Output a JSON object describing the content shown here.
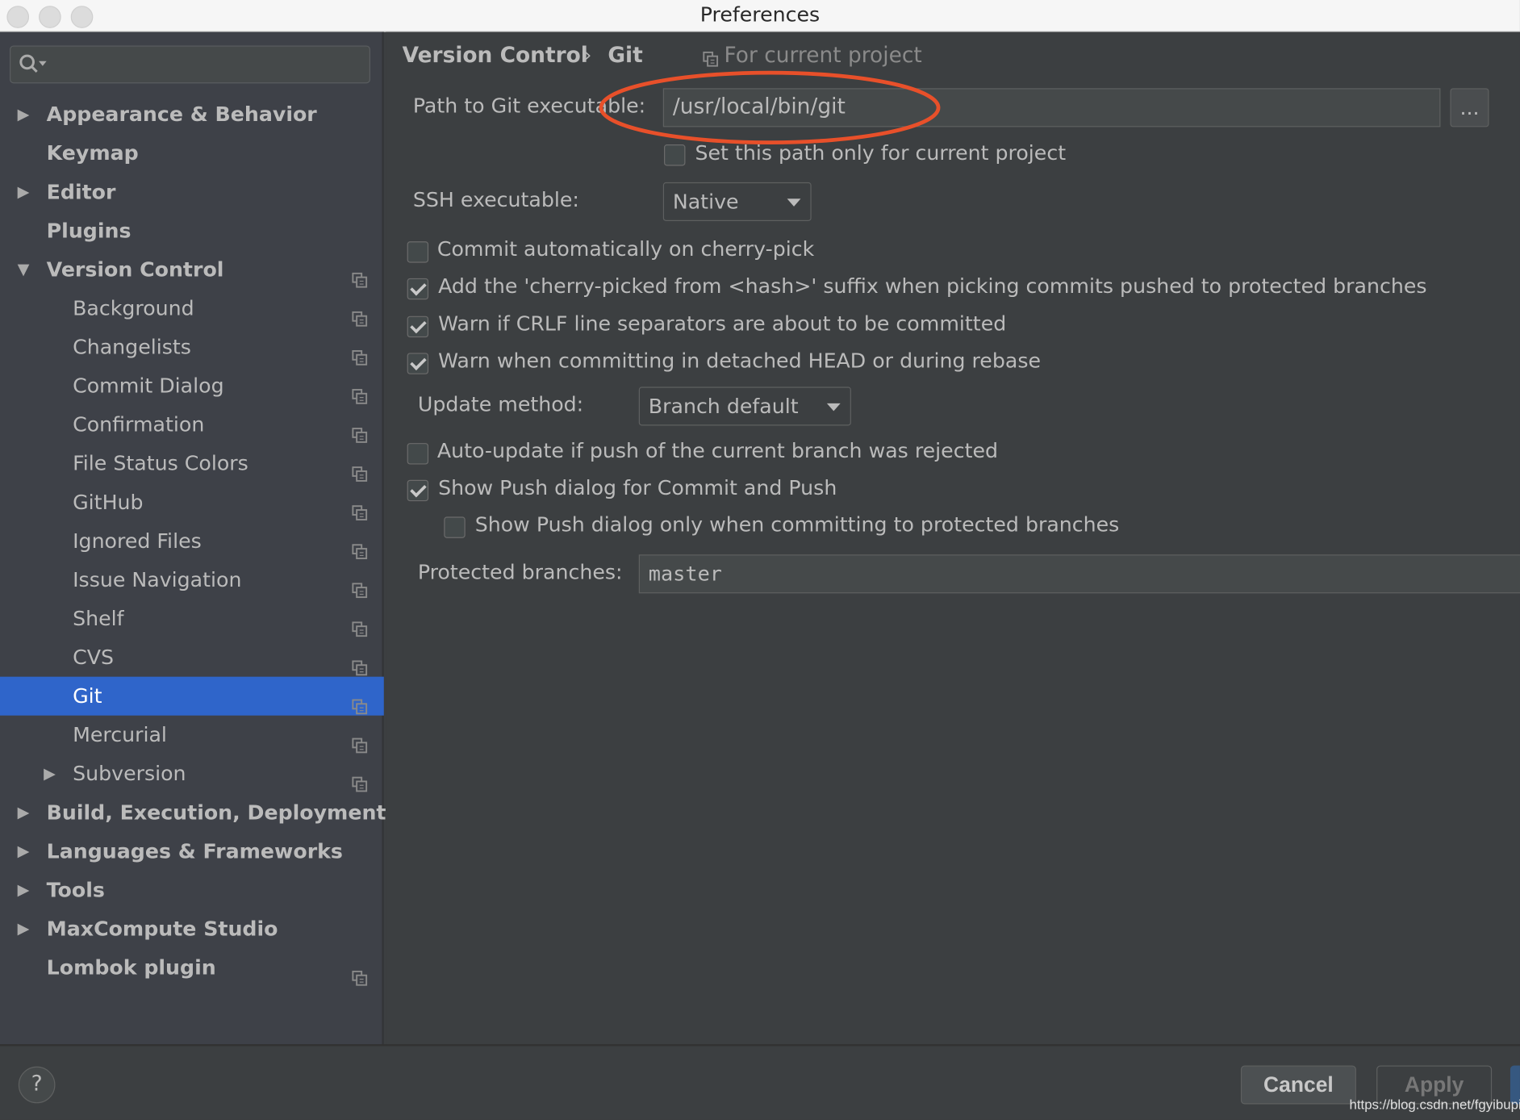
{
  "window": {
    "title": "Preferences"
  },
  "sidebar": {
    "search_placeholder": "",
    "items": [
      {
        "label": "Appearance & Behavior",
        "level": 0,
        "expandable": true,
        "expanded": false,
        "project": false
      },
      {
        "label": "Keymap",
        "level": 0,
        "expandable": false,
        "project": false
      },
      {
        "label": "Editor",
        "level": 0,
        "expandable": true,
        "expanded": false,
        "project": false
      },
      {
        "label": "Plugins",
        "level": 0,
        "expandable": false,
        "project": false
      },
      {
        "label": "Version Control",
        "level": 0,
        "expandable": true,
        "expanded": true,
        "project": true
      },
      {
        "label": "Background",
        "level": 1,
        "project": true
      },
      {
        "label": "Changelists",
        "level": 1,
        "project": true
      },
      {
        "label": "Commit Dialog",
        "level": 1,
        "project": true
      },
      {
        "label": "Confirmation",
        "level": 1,
        "project": true
      },
      {
        "label": "File Status Colors",
        "level": 1,
        "project": true
      },
      {
        "label": "GitHub",
        "level": 1,
        "project": true
      },
      {
        "label": "Ignored Files",
        "level": 1,
        "project": true
      },
      {
        "label": "Issue Navigation",
        "level": 1,
        "project": true
      },
      {
        "label": "Shelf",
        "level": 1,
        "project": true
      },
      {
        "label": "CVS",
        "level": 1,
        "project": true
      },
      {
        "label": "Git",
        "level": 1,
        "project": true,
        "selected": true
      },
      {
        "label": "Mercurial",
        "level": 1,
        "project": true
      },
      {
        "label": "Subversion",
        "level": 1,
        "expandable": true,
        "expanded": false,
        "project": true
      },
      {
        "label": "Build, Execution, Deployment",
        "level": 0,
        "expandable": true,
        "expanded": false,
        "project": false
      },
      {
        "label": "Languages & Frameworks",
        "level": 0,
        "expandable": true,
        "expanded": false,
        "project": false
      },
      {
        "label": "Tools",
        "level": 0,
        "expandable": true,
        "expanded": false,
        "project": false
      },
      {
        "label": "MaxCompute Studio",
        "level": 0,
        "expandable": true,
        "expanded": false,
        "project": false
      },
      {
        "label": "Lombok plugin",
        "level": 0,
        "expandable": false,
        "project": true
      }
    ]
  },
  "breadcrumb": {
    "parent": "Version Control",
    "separator": "›",
    "current": "Git",
    "scope": "For current project"
  },
  "git": {
    "path_label": "Path to Git executable:",
    "path_value": "/usr/local/bin/git",
    "browse_label": "...",
    "current_project_only": {
      "label": "Set this path only for current project",
      "checked": false
    },
    "ssh_label": "SSH executable:",
    "ssh_value": "Native",
    "options": [
      {
        "label": "Commit automatically on cherry-pick",
        "checked": false
      },
      {
        "label": "Add the 'cherry-picked from <hash>' suffix when picking commits pushed to protected branches",
        "checked": true
      },
      {
        "label": "Warn if CRLF line separators are about to be committed",
        "checked": true
      },
      {
        "label": "Warn when committing in detached HEAD or during rebase",
        "checked": true
      }
    ],
    "update_label": "Update method:",
    "update_value": "Branch default",
    "auto_update": {
      "label": "Auto-update if push of the current branch was rejected",
      "checked": false
    },
    "show_push": {
      "label": "Show Push dialog for Commit and Push",
      "checked": true
    },
    "show_push_protected": {
      "label": "Show Push dialog only when committing to protected branches",
      "checked": false
    },
    "protected_label": "Protected branches:",
    "protected_value": "master"
  },
  "footer": {
    "help": "?",
    "cancel": "Cancel",
    "apply": "Apply",
    "watermark": "https://blog.csdn.net/fgyibupi"
  },
  "colors": {
    "selection": "#2f65ca",
    "annotation": "#e8502a",
    "sidebar_bg": "#3e4148",
    "panel_bg": "#3c3f41"
  }
}
